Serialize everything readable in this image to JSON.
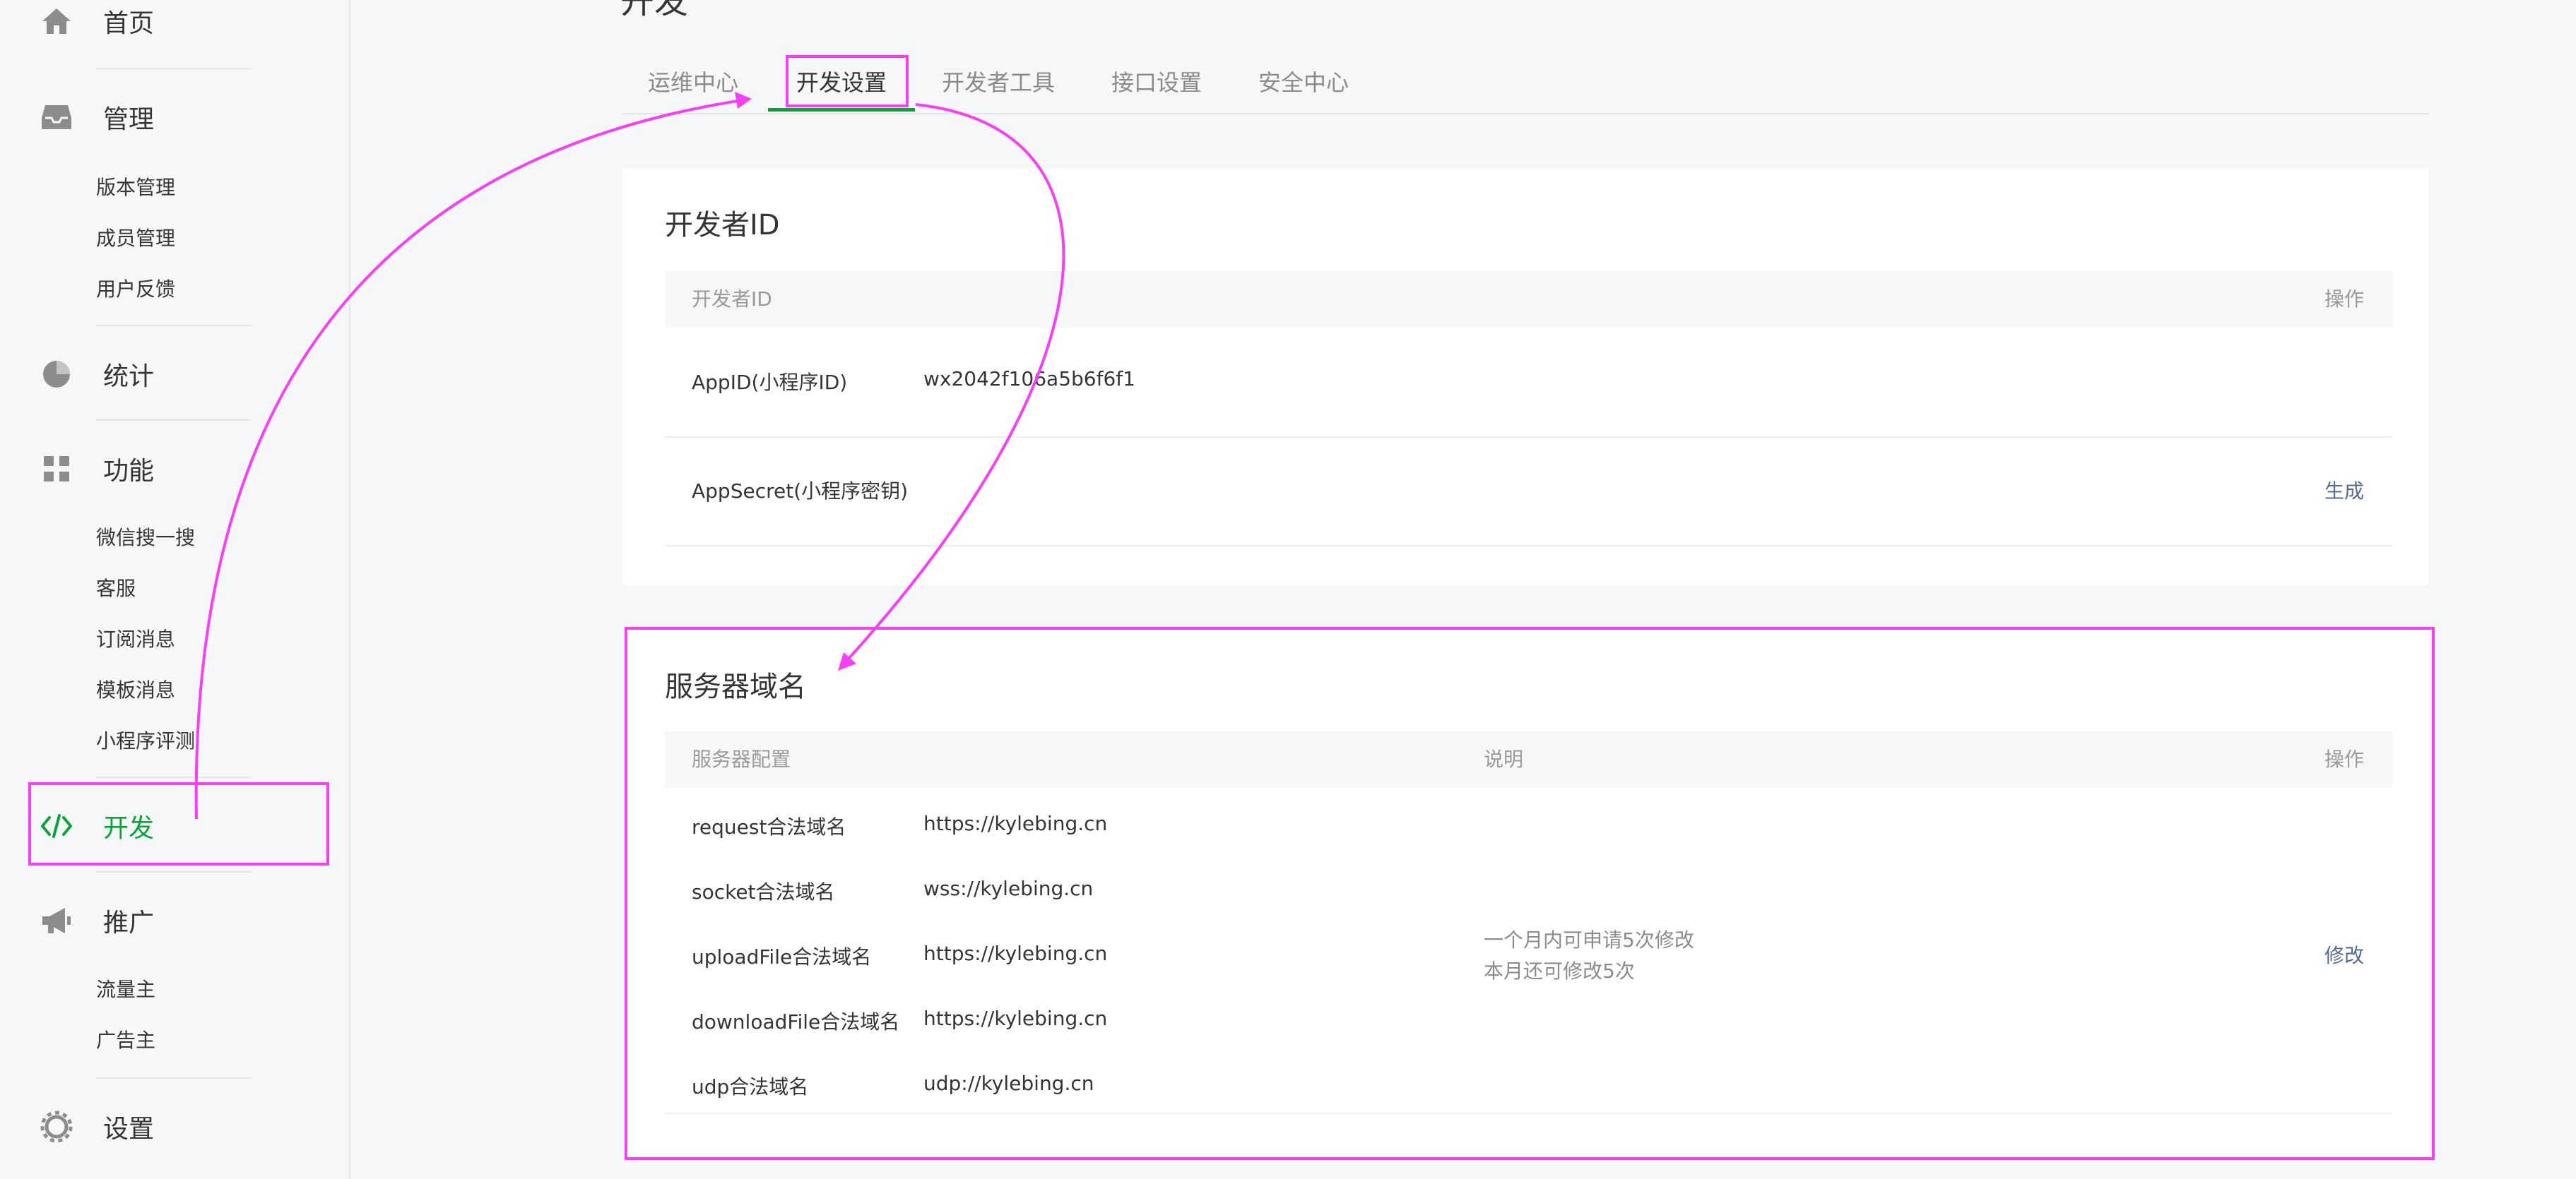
{
  "sidebar": {
    "home": "首页",
    "manage": {
      "label": "管理",
      "items": [
        "版本管理",
        "成员管理",
        "用户反馈"
      ]
    },
    "stats": "统计",
    "features": {
      "label": "功能",
      "items": [
        "微信搜一搜",
        "客服",
        "订阅消息",
        "模板消息",
        "小程序评测"
      ]
    },
    "develop": "开发",
    "promote": {
      "label": "推广",
      "items": [
        "流量主",
        "广告主"
      ]
    },
    "settings": "设置"
  },
  "page": {
    "title": "开发"
  },
  "tabs": [
    "运维中心",
    "开发设置",
    "开发者工具",
    "接口设置",
    "安全中心"
  ],
  "developer_id": {
    "title": "开发者ID",
    "header_left": "开发者ID",
    "header_action": "操作",
    "rows": [
      {
        "label": "AppID(小程序ID)",
        "value": "wx2042f106a5b6f6f1",
        "action": ""
      },
      {
        "label": "AppSecret(小程序密钥)",
        "value": "",
        "action": "生成"
      }
    ]
  },
  "server_domain": {
    "title": "服务器域名",
    "header_config": "服务器配置",
    "header_desc": "说明",
    "header_action": "操作",
    "rows": [
      {
        "label": "request合法域名",
        "value": "https://kylebing.cn"
      },
      {
        "label": "socket合法域名",
        "value": "wss://kylebing.cn"
      },
      {
        "label": "uploadFile合法域名",
        "value": "https://kylebing.cn"
      },
      {
        "label": "downloadFile合法域名",
        "value": "https://kylebing.cn"
      },
      {
        "label": "udp合法域名",
        "value": "udp://kylebing.cn"
      }
    ],
    "desc_line1": "一个月内可申请5次修改",
    "desc_line2": "本月还可修改5次",
    "action": "修改"
  },
  "colors": {
    "accent": "#09a33a",
    "link": "#576b95",
    "annotation": "#f73ff6"
  }
}
